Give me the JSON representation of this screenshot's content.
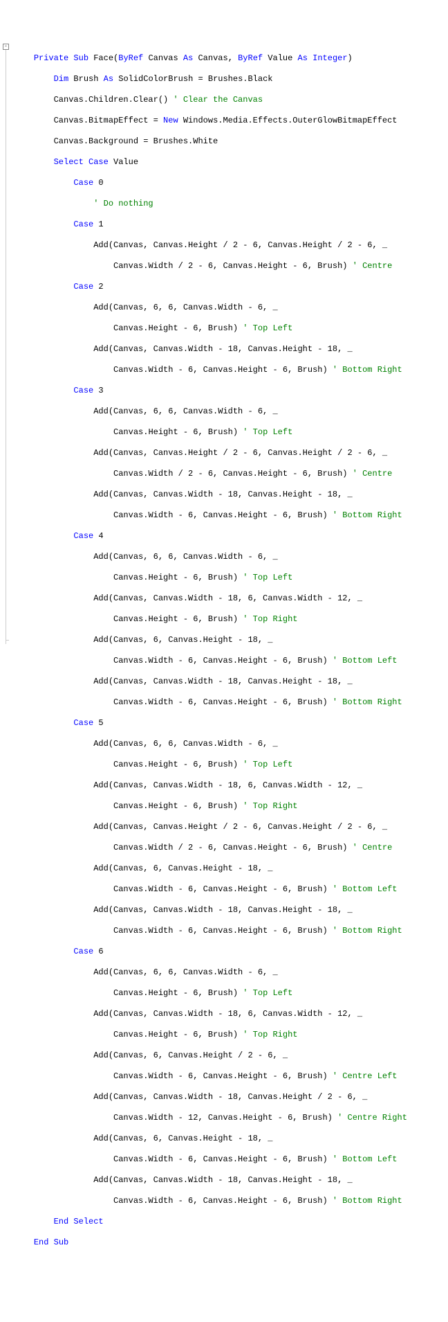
{
  "line01": {
    "sp1": "Private Sub",
    "n1": " Face(",
    "sp2": "ByRef",
    "n2": " Canvas ",
    "sp3": "As",
    "n3": " Canvas, ",
    "sp4": "ByRef",
    "n4": " Value ",
    "sp5": "As Integer",
    "n5": ")"
  },
  "line02": {
    "sp1": "Dim",
    "n1": " Brush ",
    "sp2": "As",
    "n2": " SolidColorBrush = Brushes.Black"
  },
  "line03": {
    "n1": "Canvas.Children.Clear() ",
    "c1": "' Clear the Canvas"
  },
  "line04": {
    "n1": "Canvas.BitmapEffect = ",
    "sp1": "New",
    "n2": " Windows.Media.Effects.OuterGlowBitmapEffect"
  },
  "line05": {
    "n1": "Canvas.Background = Brushes.White"
  },
  "line06": {
    "sp1": "Select Case",
    "n1": " Value"
  },
  "line07": {
    "sp1": "Case",
    "n1": " 0"
  },
  "line08": {
    "c1": "' Do nothing"
  },
  "line09": {
    "sp1": "Case",
    "n1": " 1"
  },
  "line10": {
    "n1": "Add(Canvas, Canvas.Height / 2 - 6, Canvas.Height / 2 - 6, _"
  },
  "line11": {
    "n1": "Canvas.Width / 2 - 6, Canvas.Height - 6, Brush) ",
    "c1": "' Centre"
  },
  "line12": {
    "sp1": "Case",
    "n1": " 2"
  },
  "line13": {
    "n1": "Add(Canvas, 6, 6, Canvas.Width - 6, _"
  },
  "line14": {
    "n1": "Canvas.Height - 6, Brush) ",
    "c1": "' Top Left"
  },
  "line15": {
    "n1": "Add(Canvas, Canvas.Width - 18, Canvas.Height - 18, _"
  },
  "line16": {
    "n1": "Canvas.Width - 6, Canvas.Height - 6, Brush) ",
    "c1": "' Bottom Right"
  },
  "line17": {
    "sp1": "Case",
    "n1": " 3"
  },
  "line18": {
    "n1": "Add(Canvas, 6, 6, Canvas.Width - 6, _"
  },
  "line19": {
    "n1": "Canvas.Height - 6, Brush) ",
    "c1": "' Top Left"
  },
  "line20": {
    "n1": "Add(Canvas, Canvas.Height / 2 - 6, Canvas.Height / 2 - 6, _"
  },
  "line21": {
    "n1": "Canvas.Width / 2 - 6, Canvas.Height - 6, Brush) ",
    "c1": "' Centre"
  },
  "line22": {
    "n1": "Add(Canvas, Canvas.Width - 18, Canvas.Height - 18, _"
  },
  "line23": {
    "n1": "Canvas.Width - 6, Canvas.Height - 6, Brush) ",
    "c1": "' Bottom Right"
  },
  "line24": {
    "sp1": "Case",
    "n1": " 4"
  },
  "line25": {
    "n1": "Add(Canvas, 6, 6, Canvas.Width - 6, _"
  },
  "line26": {
    "n1": "Canvas.Height - 6, Brush) ",
    "c1": "' Top Left"
  },
  "line27": {
    "n1": "Add(Canvas, Canvas.Width - 18, 6, Canvas.Width - 12, _"
  },
  "line28": {
    "n1": "Canvas.Height - 6, Brush) ",
    "c1": "' Top Right"
  },
  "line29": {
    "n1": "Add(Canvas, 6, Canvas.Height - 18, _"
  },
  "line30": {
    "n1": "Canvas.Width - 6, Canvas.Height - 6, Brush) ",
    "c1": "' Bottom Left"
  },
  "line31": {
    "n1": "Add(Canvas, Canvas.Width - 18, Canvas.Height - 18, _"
  },
  "line32": {
    "n1": "Canvas.Width - 6, Canvas.Height - 6, Brush) ",
    "c1": "' Bottom Right"
  },
  "line33": {
    "sp1": "Case",
    "n1": " 5"
  },
  "line34": {
    "n1": "Add(Canvas, 6, 6, Canvas.Width - 6, _"
  },
  "line35": {
    "n1": "Canvas.Height - 6, Brush) ",
    "c1": "' Top Left"
  },
  "line36": {
    "n1": "Add(Canvas, Canvas.Width - 18, 6, Canvas.Width - 12, _"
  },
  "line37": {
    "n1": "Canvas.Height - 6, Brush) ",
    "c1": "' Top Right"
  },
  "line38": {
    "n1": "Add(Canvas, Canvas.Height / 2 - 6, Canvas.Height / 2 - 6, _"
  },
  "line39": {
    "n1": "Canvas.Width / 2 - 6, Canvas.Height - 6, Brush) ",
    "c1": "' Centre"
  },
  "line40": {
    "n1": "Add(Canvas, 6, Canvas.Height - 18, _"
  },
  "line41": {
    "n1": "Canvas.Width - 6, Canvas.Height - 6, Brush) ",
    "c1": "' Bottom Left"
  },
  "line42": {
    "n1": "Add(Canvas, Canvas.Width - 18, Canvas.Height - 18, _"
  },
  "line43": {
    "n1": "Canvas.Width - 6, Canvas.Height - 6, Brush) ",
    "c1": "' Bottom Right"
  },
  "line44": {
    "sp1": "Case",
    "n1": " 6"
  },
  "line45": {
    "n1": "Add(Canvas, 6, 6, Canvas.Width - 6, _"
  },
  "line46": {
    "n1": "Canvas.Height - 6, Brush) ",
    "c1": "' Top Left"
  },
  "line47": {
    "n1": "Add(Canvas, Canvas.Width - 18, 6, Canvas.Width - 12, _"
  },
  "line48": {
    "n1": "Canvas.Height - 6, Brush) ",
    "c1": "' Top Right"
  },
  "line49": {
    "n1": "Add(Canvas, 6, Canvas.Height / 2 - 6, _"
  },
  "line50": {
    "n1": "Canvas.Width - 6, Canvas.Height - 6, Brush) ",
    "c1": "' Centre Left"
  },
  "line51": {
    "n1": "Add(Canvas, Canvas.Width - 18, Canvas.Height / 2 - 6, _"
  },
  "line52": {
    "n1": "Canvas.Width - 12, Canvas.Height - 6, Brush) ",
    "c1": "' Centre Right"
  },
  "line53": {
    "n1": "Add(Canvas, 6, Canvas.Height - 18, _"
  },
  "line54": {
    "n1": "Canvas.Width - 6, Canvas.Height - 6, Brush) ",
    "c1": "' Bottom Left"
  },
  "line55": {
    "n1": "Add(Canvas, Canvas.Width - 18, Canvas.Height - 18, _"
  },
  "line56": {
    "n1": "Canvas.Width - 6, Canvas.Height - 6, Brush) ",
    "c1": "' Bottom Right"
  },
  "line57": {
    "sp1": "End Select"
  },
  "line58": {
    "sp1": "End Sub"
  }
}
